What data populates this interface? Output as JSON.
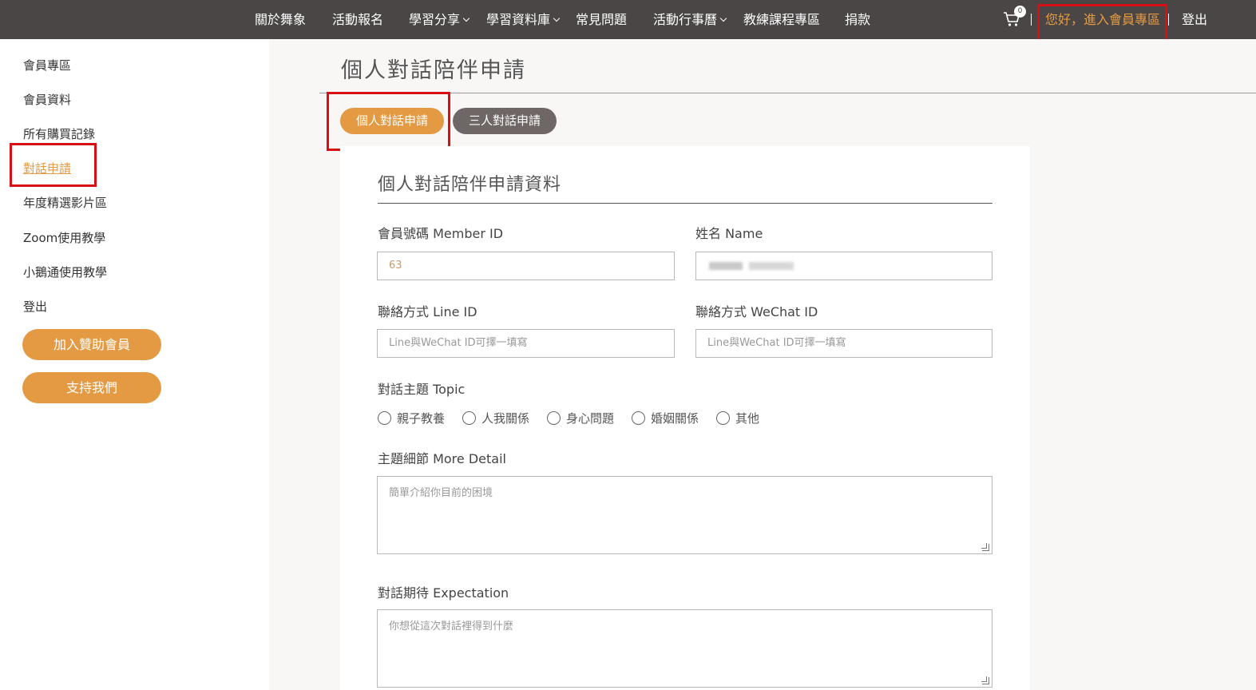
{
  "nav": {
    "items": [
      {
        "label": "關於舞象",
        "dropdown": false
      },
      {
        "label": "活動報名",
        "dropdown": false
      },
      {
        "label": "學習分享",
        "dropdown": true
      },
      {
        "label": "學習資料庫",
        "dropdown": true
      },
      {
        "label": "常見問題",
        "dropdown": false
      },
      {
        "label": "活動行事曆",
        "dropdown": true
      },
      {
        "label": "教練課程專區",
        "dropdown": false
      },
      {
        "label": "捐款",
        "dropdown": false
      }
    ],
    "cart_count": "0",
    "member_link": "您好，進入會員專區",
    "logout": "登出"
  },
  "sidebar": {
    "items": [
      {
        "label": "會員專區"
      },
      {
        "label": "會員資料"
      },
      {
        "label": "所有購買記錄"
      },
      {
        "label": "對話申請"
      },
      {
        "label": "年度精選影片區"
      },
      {
        "label": "Zoom使用教學"
      },
      {
        "label": "小鵝通使用教學"
      },
      {
        "label": "登出"
      }
    ],
    "active_index": 3,
    "buttons": [
      {
        "label": "加入贊助會員"
      },
      {
        "label": "支持我們"
      }
    ]
  },
  "main": {
    "title": "個人對話陪伴申請",
    "tabs": [
      {
        "label": "個人對話申請",
        "active": true
      },
      {
        "label": "三人對話申請",
        "active": false
      }
    ]
  },
  "form": {
    "title": "個人對話陪伴申請資料",
    "member_id": {
      "label": "會員號碼 Member ID",
      "value": "63"
    },
    "name": {
      "label": "姓名 Name",
      "value": ""
    },
    "line_id": {
      "label": "聯絡方式 Line ID",
      "placeholder": "Line與WeChat ID可擇一填寫"
    },
    "wechat_id": {
      "label": "聯絡方式 WeChat ID",
      "placeholder": "Line與WeChat ID可擇一填寫"
    },
    "topic": {
      "label": "對話主題 Topic",
      "options": [
        "親子教養",
        "人我關係",
        "身心問題",
        "婚姻關係",
        "其他"
      ]
    },
    "detail": {
      "label": "主題細節 More Detail",
      "placeholder": "簡單介紹你目前的困境"
    },
    "expectation": {
      "label": "對話期待 Expectation",
      "placeholder": "你想從這次對話裡得到什麼"
    }
  },
  "colors": {
    "topbar": "#4a4645",
    "accent": "#e39a43",
    "tab_inactive": "#6f6766",
    "highlight": "#d80f15"
  }
}
